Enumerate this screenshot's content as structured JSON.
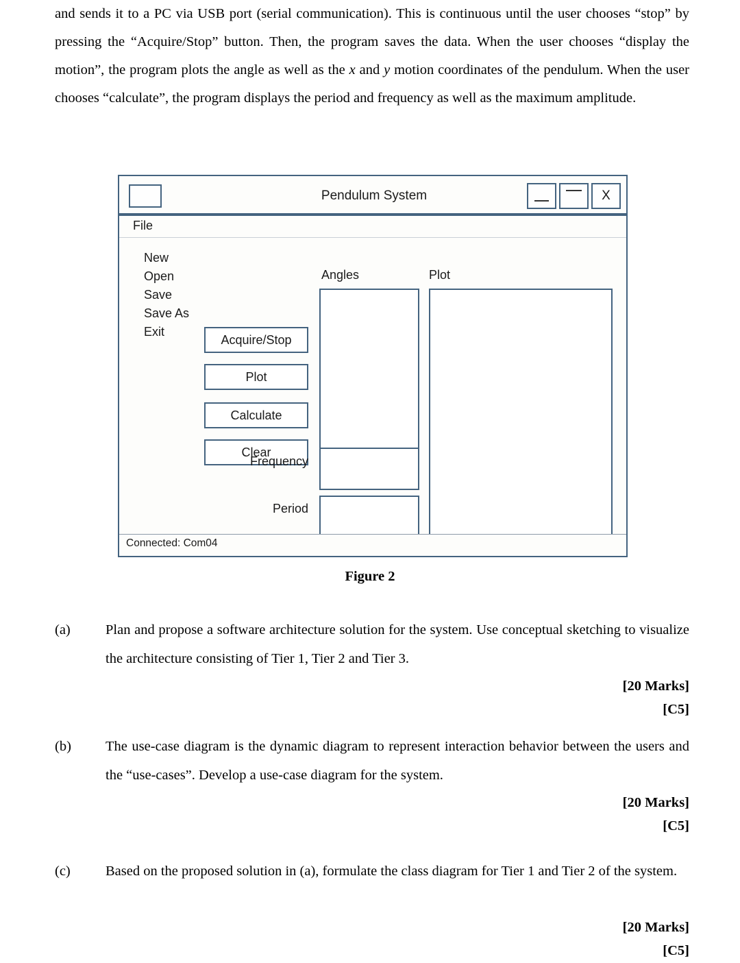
{
  "document": {
    "intro_paragraph": "and sends it to a PC via USB port (serial communication). This is continuous until the user chooses “stop” by pressing the “Acquire/Stop” button. Then, the program saves the data. When the user chooses “display the motion”, the program plots the angle as well as the x and y motion coordinates of the pendulum. When the user chooses “calculate”, the program displays the period and frequency as well as the maximum amplitude.",
    "intro_seg1": "and sends it to a PC via USB port (serial communication). This is continuous until the user chooses “stop” by pressing the “Acquire/Stop” button. Then, the program saves the data. When the user chooses “display the motion”, the program plots the angle as well as the ",
    "intro_x": "x",
    "intro_seg2": " and ",
    "intro_y": "y",
    "intro_seg3": " motion coordinates of the pendulum. When the user chooses “calculate”, the program displays the period and frequency as well as the maximum amplitude.",
    "figure_caption": "Figure 2"
  },
  "mockup": {
    "title": "Pendulum System",
    "icon_name": "app-icon-placeholder",
    "window_buttons": [
      {
        "name": "minimize",
        "label": ""
      },
      {
        "name": "maximize",
        "label": ""
      },
      {
        "name": "close",
        "label": "X"
      }
    ],
    "menubar": {
      "label": "File"
    },
    "menu_items": [
      "New",
      "Open",
      "Save",
      "Save As",
      "Exit"
    ],
    "buttons": [
      "Acquire/Stop",
      "Plot",
      "Calculate",
      "Clear"
    ],
    "field_labels": {
      "frequency": "Frequency",
      "period": "Period"
    },
    "panel_labels": {
      "angles": "Angles",
      "plot": "Plot"
    },
    "field_values": {
      "frequency": "",
      "period": ""
    },
    "statusbar": "Connected: Com04",
    "colors": {
      "border": "#44637f",
      "panel_bg": "#ffffff",
      "window_bg": "#fdfdfb",
      "separator": "#c9cfd6"
    }
  },
  "questions": [
    {
      "letter": "(a)",
      "text": "Plan and propose a software architecture solution for the system. Use conceptual sketching to visualize the architecture consisting of Tier 1, Tier 2 and Tier 3.",
      "marks": "[20 Marks]",
      "code": "[C5]"
    },
    {
      "letter": "(b)",
      "text": "The use-case diagram is the dynamic diagram to represent interaction behavior between the users and the “use-cases”. Develop a use-case diagram for the system.",
      "marks": "[20 Marks]",
      "code": "[C5]"
    },
    {
      "letter": "(c)",
      "text": "Based on the proposed solution in (a), formulate the class diagram for Tier 1 and Tier 2 of the system.",
      "marks": "[20 Marks]",
      "code": "[C5]"
    }
  ]
}
